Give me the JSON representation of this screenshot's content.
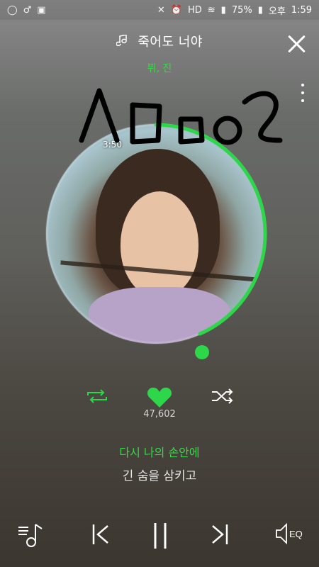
{
  "status_bar": {
    "left_icons": [
      "app-icon",
      "record-icon",
      "notification-icon"
    ],
    "battery": "75%",
    "ampm": "오후",
    "time": "1:59"
  },
  "player": {
    "song_title": "죽어도 너야",
    "artist": "뷔, 진",
    "art_time": "3:50",
    "like_count": "47,602"
  },
  "lyrics": {
    "current": "다시 나의 손안에",
    "next": "긴 숨을 삼키고"
  },
  "handwriting": "스ᄆᄋ2",
  "colors": {
    "accent": "#2ed64a",
    "background_top": "#8a8a8a",
    "background_bottom": "#3b362f"
  },
  "bottom": {
    "eq_label": "EQ"
  }
}
